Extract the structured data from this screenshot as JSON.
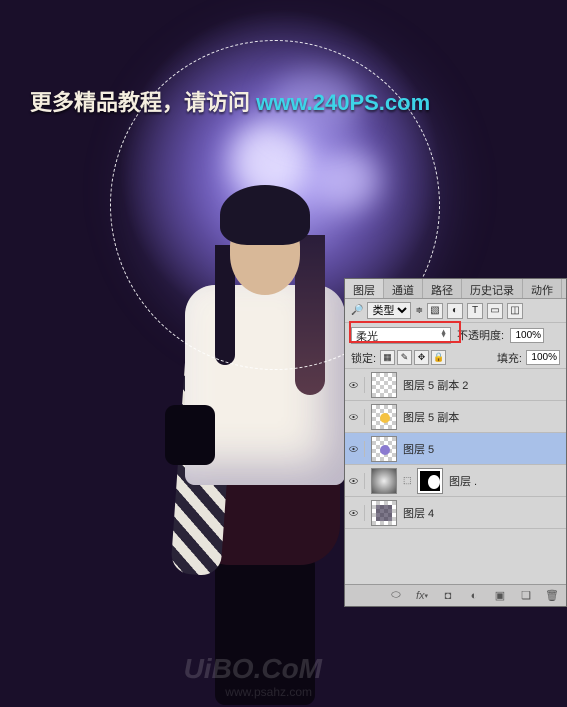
{
  "banner": {
    "text_cn": "更多精品教程，请访问 ",
    "url": "www.240PS.com"
  },
  "watermark": {
    "line1": "UiBO.CoM",
    "line2": "www.psahz.com"
  },
  "panel": {
    "tabs": [
      "图层",
      "通道",
      "路径",
      "历史记录",
      "动作"
    ],
    "active_tab_index": 0,
    "kind_label": "类型",
    "filter_icons": [
      "img",
      "adj",
      "T",
      "shape",
      "smart"
    ],
    "blend_mode": "柔光",
    "opacity_label": "不透明度:",
    "opacity_value": "100%",
    "lock_label": "锁定:",
    "lock_icons": [
      "transparent",
      "brush",
      "move",
      "lock"
    ],
    "fill_label": "填充:",
    "fill_value": "100%",
    "layers": [
      {
        "visible": true,
        "name": "图层 5 副本 2",
        "thumb": "checker",
        "dot": null,
        "mask": null,
        "selected": false
      },
      {
        "visible": true,
        "name": "图层 5 副本",
        "thumb": "checker",
        "dot": "#f5c242",
        "mask": null,
        "selected": false
      },
      {
        "visible": true,
        "name": "图层 5",
        "thumb": "checker",
        "dot": "#8a7ad0",
        "mask": null,
        "selected": true
      },
      {
        "visible": true,
        "name": "图层 .",
        "thumb": "clouds",
        "dot": null,
        "mask": true,
        "selected": false
      },
      {
        "visible": true,
        "name": "图层 4",
        "thumb": "checker-dark",
        "dot": null,
        "mask": null,
        "selected": false
      }
    ],
    "footer_icons": [
      "link",
      "fx",
      "mask",
      "adjust",
      "group",
      "new",
      "trash"
    ]
  }
}
